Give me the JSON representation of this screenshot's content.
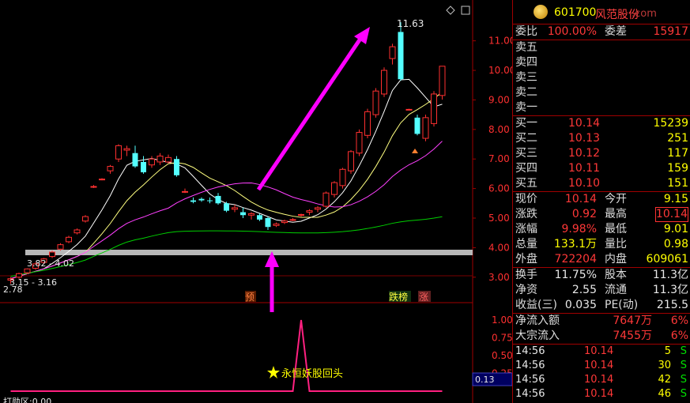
{
  "stock": {
    "code": "601700",
    "name": "风范股份",
    "watermark": ".com"
  },
  "order_book": {
    "ratio_label": "委比",
    "ratio_value": "100.00%",
    "diff_label": "委差",
    "diff_value": "15917",
    "asks": [
      {
        "label": "卖五",
        "price": "",
        "vol": ""
      },
      {
        "label": "卖四",
        "price": "",
        "vol": ""
      },
      {
        "label": "卖三",
        "price": "",
        "vol": ""
      },
      {
        "label": "卖二",
        "price": "",
        "vol": ""
      },
      {
        "label": "卖一",
        "price": "",
        "vol": ""
      }
    ],
    "bids": [
      {
        "label": "买一",
        "price": "10.14",
        "vol": "15239"
      },
      {
        "label": "买二",
        "price": "10.13",
        "vol": "251"
      },
      {
        "label": "买三",
        "price": "10.12",
        "vol": "117"
      },
      {
        "label": "买四",
        "price": "10.11",
        "vol": "159"
      },
      {
        "label": "买五",
        "price": "10.10",
        "vol": "151"
      }
    ]
  },
  "quote": [
    {
      "l1": "现价",
      "v1": "10.14",
      "c1": "red",
      "l2": "今开",
      "v2": "9.15",
      "c2": "yellow"
    },
    {
      "l1": "涨跌",
      "v1": "0.92",
      "c1": "red",
      "l2": "最高",
      "v2": "10.14",
      "c2": "red",
      "boxed": true
    },
    {
      "l1": "涨幅",
      "v1": "9.98%",
      "c1": "red",
      "l2": "最低",
      "v2": "9.01",
      "c2": "yellow"
    },
    {
      "l1": "总量",
      "v1": "133.1万",
      "c1": "yellow",
      "l2": "量比",
      "v2": "0.98",
      "c2": "yellow"
    },
    {
      "l1": "外盘",
      "v1": "722204",
      "c1": "red",
      "l2": "内盘",
      "v2": "609061",
      "c2": "yellow"
    }
  ],
  "fundamentals": [
    {
      "l1": "换手",
      "v1": "11.75%",
      "l2": "股本",
      "v2": "11.3亿"
    },
    {
      "l1": "净资",
      "v1": "2.55",
      "l2": "流通",
      "v2": "11.3亿"
    },
    {
      "l1": "收益(三)",
      "v1": "0.035",
      "l2": "PE(动)",
      "v2": "215.5"
    }
  ],
  "flows": [
    {
      "label": "净流入额",
      "value": "7647万",
      "pct": "6%"
    },
    {
      "label": "大宗流入",
      "value": "7455万",
      "pct": "6%"
    }
  ],
  "ticks": [
    {
      "time": "14:56",
      "price": "10.14",
      "vol": "5",
      "side": "S"
    },
    {
      "time": "14:56",
      "price": "10.14",
      "vol": "30",
      "side": "S"
    },
    {
      "time": "14:56",
      "price": "10.14",
      "vol": "42",
      "side": "S"
    },
    {
      "time": "14:56",
      "price": "10.14",
      "vol": "46",
      "side": "S"
    }
  ],
  "chart": {
    "y_ticks": [
      "11.00",
      "10.00",
      "9.00",
      "8.00",
      "7.00",
      "6.00",
      "5.00",
      "4.00",
      "3.00"
    ],
    "sub_ticks": [
      "1.00",
      "0.75",
      "0.50",
      "0.25"
    ],
    "high_label": "11.63",
    "zone_label": "3.82 - 4.02",
    "zone2_label": "3.15 - 3.16",
    "low_label": "2.78",
    "marker_pre": "预",
    "marker_longhu": "跌榜",
    "marker_zhang": "涨",
    "indicator_name": "永恒妖股回头",
    "indicator_value": "0.13",
    "bottom_label": "打勋区:0.00"
  },
  "chart_data": {
    "type": "candlestick",
    "title": "",
    "ylim": [
      2.7,
      11.9
    ],
    "candles": [
      {
        "o": 2.9,
        "h": 3.0,
        "l": 2.78,
        "c": 2.95
      },
      {
        "o": 3.0,
        "h": 3.15,
        "l": 2.95,
        "c": 3.12
      },
      {
        "o": 3.15,
        "h": 3.3,
        "l": 3.1,
        "c": 3.28
      },
      {
        "o": 3.3,
        "h": 3.5,
        "l": 3.25,
        "c": 3.45
      },
      {
        "o": 3.5,
        "h": 3.65,
        "l": 3.45,
        "c": 3.62
      },
      {
        "o": 3.7,
        "h": 3.9,
        "l": 3.65,
        "c": 3.85
      },
      {
        "o": 3.95,
        "h": 4.15,
        "l": 3.9,
        "c": 4.1
      },
      {
        "o": 4.2,
        "h": 4.4,
        "l": 4.15,
        "c": 4.35
      },
      {
        "o": 4.5,
        "h": 4.65,
        "l": 4.45,
        "c": 4.6
      },
      {
        "o": 4.9,
        "h": 5.1,
        "l": 4.85,
        "c": 5.05
      },
      {
        "o": 6.05,
        "h": 6.12,
        "l": 6.02,
        "c": 6.07
      },
      {
        "o": 6.3,
        "h": 6.35,
        "l": 6.28,
        "c": 6.32
      },
      {
        "o": 6.6,
        "h": 6.8,
        "l": 6.5,
        "c": 6.75
      },
      {
        "o": 7.0,
        "h": 7.5,
        "l": 6.9,
        "c": 7.45
      },
      {
        "o": 7.3,
        "h": 7.45,
        "l": 7.1,
        "c": 7.35
      },
      {
        "o": 7.2,
        "h": 7.45,
        "l": 6.7,
        "c": 6.75
      },
      {
        "o": 6.9,
        "h": 7.1,
        "l": 6.5,
        "c": 6.55
      },
      {
        "o": 6.8,
        "h": 7.1,
        "l": 6.7,
        "c": 7.0
      },
      {
        "o": 6.9,
        "h": 7.2,
        "l": 6.8,
        "c": 7.1
      },
      {
        "o": 6.9,
        "h": 7.15,
        "l": 6.85,
        "c": 7.05
      },
      {
        "o": 7.0,
        "h": 7.1,
        "l": 6.4,
        "c": 6.45
      },
      {
        "o": 5.9,
        "h": 6.0,
        "l": 5.85,
        "c": 5.9
      },
      {
        "o": 5.6,
        "h": 5.7,
        "l": 5.5,
        "c": 5.55
      },
      {
        "o": 5.65,
        "h": 5.7,
        "l": 5.55,
        "c": 5.6
      },
      {
        "o": 5.6,
        "h": 5.7,
        "l": 5.5,
        "c": 5.58
      },
      {
        "o": 5.75,
        "h": 5.85,
        "l": 5.45,
        "c": 5.5
      },
      {
        "o": 5.5,
        "h": 5.55,
        "l": 5.2,
        "c": 5.25
      },
      {
        "o": 5.3,
        "h": 5.45,
        "l": 5.2,
        "c": 5.35
      },
      {
        "o": 5.2,
        "h": 5.35,
        "l": 5.0,
        "c": 5.1
      },
      {
        "o": 5.1,
        "h": 5.2,
        "l": 4.95,
        "c": 5.15
      },
      {
        "o": 5.1,
        "h": 5.15,
        "l": 4.9,
        "c": 4.95
      },
      {
        "o": 5.0,
        "h": 5.05,
        "l": 4.6,
        "c": 4.7
      },
      {
        "o": 4.75,
        "h": 4.85,
        "l": 4.7,
        "c": 4.8
      },
      {
        "o": 4.85,
        "h": 4.95,
        "l": 4.8,
        "c": 4.9
      },
      {
        "o": 4.95,
        "h": 5.0,
        "l": 4.9,
        "c": 4.95
      },
      {
        "o": 5.1,
        "h": 5.15,
        "l": 5.05,
        "c": 5.12
      },
      {
        "o": 5.2,
        "h": 5.3,
        "l": 5.1,
        "c": 5.25
      },
      {
        "o": 5.3,
        "h": 5.4,
        "l": 5.2,
        "c": 5.35
      },
      {
        "o": 5.4,
        "h": 5.9,
        "l": 5.35,
        "c": 5.85
      },
      {
        "o": 5.8,
        "h": 6.25,
        "l": 5.7,
        "c": 6.2
      },
      {
        "o": 6.1,
        "h": 6.7,
        "l": 6.0,
        "c": 6.65
      },
      {
        "o": 6.6,
        "h": 7.3,
        "l": 6.5,
        "c": 7.25
      },
      {
        "o": 7.2,
        "h": 8.0,
        "l": 7.1,
        "c": 7.9
      },
      {
        "o": 7.8,
        "h": 8.7,
        "l": 7.7,
        "c": 8.6
      },
      {
        "o": 8.5,
        "h": 9.4,
        "l": 8.4,
        "c": 9.3
      },
      {
        "o": 9.2,
        "h": 10.1,
        "l": 9.1,
        "c": 10.0
      },
      {
        "o": 10.4,
        "h": 10.9,
        "l": 10.2,
        "c": 10.8
      },
      {
        "o": 11.3,
        "h": 11.63,
        "l": 9.65,
        "c": 9.7
      },
      {
        "o": 8.68,
        "h": 8.7,
        "l": 8.65,
        "c": 8.68
      },
      {
        "o": 8.4,
        "h": 8.5,
        "l": 7.8,
        "c": 7.85
      },
      {
        "o": 7.7,
        "h": 8.5,
        "l": 7.6,
        "c": 8.4
      },
      {
        "o": 8.2,
        "h": 9.3,
        "l": 8.1,
        "c": 9.2
      },
      {
        "o": 9.15,
        "h": 10.14,
        "l": 9.01,
        "c": 10.14
      }
    ],
    "indicator": [
      0,
      0,
      0,
      0,
      0,
      0,
      0,
      0,
      0,
      0,
      0,
      0,
      0,
      0,
      0,
      0,
      0,
      0,
      0,
      0,
      0,
      0,
      0,
      0,
      0,
      0,
      0,
      0,
      0,
      0,
      0,
      0,
      0,
      0,
      0,
      1.0,
      0,
      0,
      0,
      0,
      0,
      0,
      0,
      0,
      0,
      0,
      0,
      0,
      0,
      0,
      0,
      0,
      0
    ]
  },
  "colors": {
    "up": "#ff3030",
    "down": "#54ffff",
    "ma5": "#ffffff",
    "ma10": "#ffff80",
    "ma20": "#ff40ff",
    "ma60": "#00d000",
    "arrow": "#ff00ff",
    "border": "#a00000"
  }
}
